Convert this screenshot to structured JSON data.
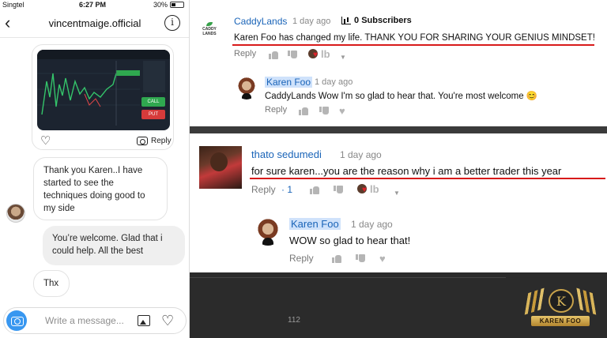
{
  "status_bar": {
    "carrier": "Singtel",
    "time": "6:27 PM",
    "battery": "30%"
  },
  "instagram": {
    "username": "vincentmaige.official",
    "back_glyph": "‹",
    "info_glyph": "i",
    "shared_post": {
      "button_call": "CALL",
      "button_put": "PUT",
      "reply_label": "Reply"
    },
    "messages": [
      {
        "direction": "incoming",
        "text": "Thank you Karen..I have started to see the techniques doing good to my side"
      },
      {
        "direction": "outgoing",
        "text": "You’re welcome. Glad that i could help. All the best"
      },
      {
        "direction": "incoming",
        "text": "Thx"
      }
    ],
    "composer": {
      "placeholder": "Write a message..."
    },
    "icons": [
      "back-icon",
      "info-icon",
      "heart-icon",
      "camera-icon",
      "image-icon"
    ]
  },
  "youtube": {
    "comments": [
      {
        "author": "CaddyLands",
        "channel_logo_text": "CADDY LANDS",
        "time": "1 day ago",
        "subscribers_count": "0",
        "subscribers_label": "Subscribers",
        "text": "Karen Foo has changed my life. THANK YOU FOR SHARING YOUR GENIUS MINDSET!",
        "reply_label": "Reply",
        "reply": {
          "author": "Karen Foo",
          "time": "1 day ago",
          "text": "CaddyLands Wow I'm so glad to hear that. You're most welcome 😊",
          "reply_label": "Reply"
        }
      },
      {
        "author": "thato sedumedi",
        "time": "1 day ago",
        "text": "for sure karen...you are the reason why i am a better trader this year",
        "reply_label": "Reply",
        "likes": "1",
        "reply": {
          "author": "Karen Foo",
          "time": "1 day ago",
          "text": "WOW so glad to hear that!",
          "reply_label": "Reply"
        }
      }
    ],
    "creator_heart_label": "lb",
    "caret_glyph": "▼",
    "page_number": "112",
    "brand_name": "KAREN FOO",
    "brand_monogram": "K",
    "highlight_color": "#cfe2fb",
    "underline_color": "#d81a1a"
  }
}
